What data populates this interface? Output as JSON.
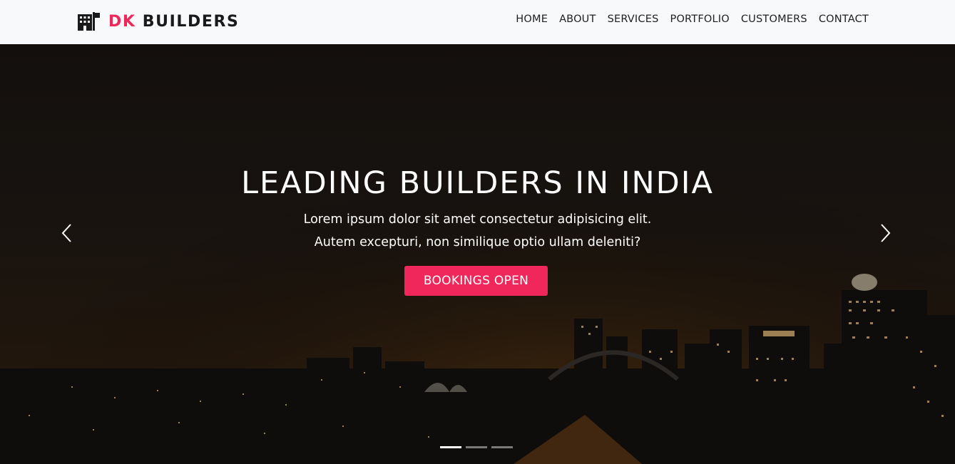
{
  "navbar": {
    "brand": {
      "accent": "DK",
      "name": "BUILDERS",
      "icon": "building-icon"
    },
    "links": [
      "HOME",
      "ABOUT",
      "SERVICES",
      "PORTFOLIO",
      "CUSTOMERS",
      "CONTACT"
    ]
  },
  "hero": {
    "title": "LEADING BUILDERS IN INDIA",
    "subtitle_line1": "Lorem ipsum dolor sit amet consectetur adipisicing elit.",
    "subtitle_line2": "Autem excepturi, non similique optio ullam deleniti?",
    "cta_label": "BOOKINGS OPEN",
    "prev_icon": "chevron-left-icon",
    "next_icon": "chevron-right-icon",
    "slides_total": 3,
    "active_slide": 1
  },
  "colors": {
    "accent": "#f0275a",
    "navbar_bg": "#f8f9fa",
    "text_dark": "#1f1f1f"
  }
}
